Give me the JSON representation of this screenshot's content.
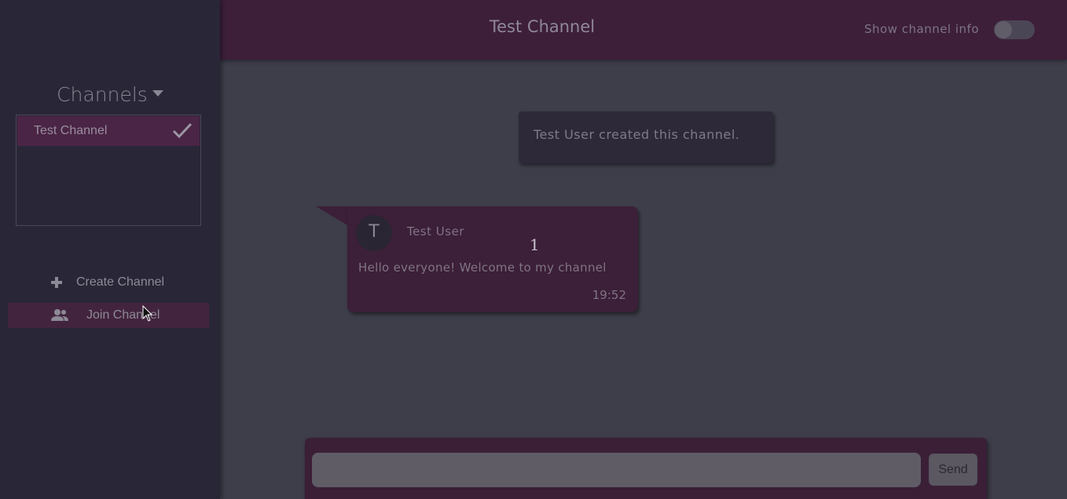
{
  "sidebar": {
    "heading": "Channels",
    "channels": [
      {
        "label": "Test Channel",
        "selected": true
      }
    ],
    "actions": {
      "create": "Create Channel",
      "join": "Join Channel"
    }
  },
  "header": {
    "title": "Test Channel",
    "info_label": "Show channel info",
    "info_toggle_on": false
  },
  "messages": {
    "system": "Test User created this channel.",
    "items": [
      {
        "avatar_initial": "T",
        "user": "Test User",
        "marker": "1",
        "text": "Hello everyone! Welcome to my channel",
        "time": "19:52"
      }
    ]
  },
  "composer": {
    "value": "",
    "placeholder": "",
    "send_label": "Send"
  },
  "colors": {
    "accent": "#3d1f3a",
    "sidebar": "#292637",
    "main": "#3e3e4a"
  },
  "icons": [
    "caret-down-icon",
    "check-icon",
    "plus-icon",
    "users-icon",
    "cursor-icon"
  ]
}
